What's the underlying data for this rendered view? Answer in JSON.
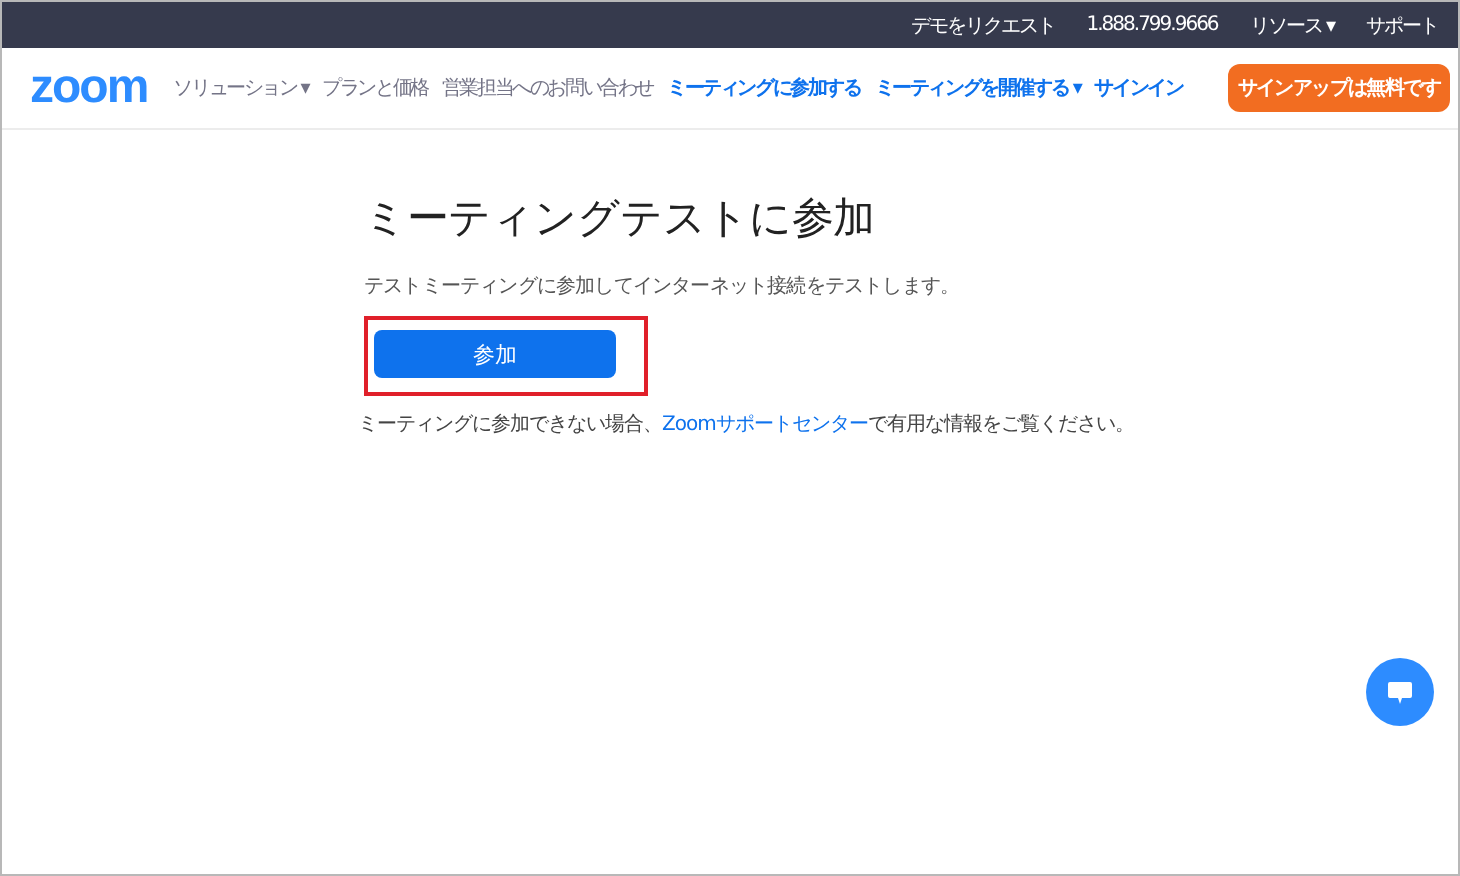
{
  "top_bar": {
    "links": [
      "デモをリクエスト",
      "1.888.799.9666",
      "リソース ▾",
      "サポート"
    ]
  },
  "nav": {
    "logo": "zoom",
    "items": [
      {
        "label": "ソリューション ▾",
        "kind": "plain"
      },
      {
        "label": "プランと価格",
        "kind": "plain"
      },
      {
        "label": "営業担当へのお問い合わせ",
        "kind": "plain"
      },
      {
        "label": "ミーティングに参加する",
        "kind": "accent"
      },
      {
        "label": "ミーティングを開催する ▾",
        "kind": "accent"
      },
      {
        "label": "サインイン",
        "kind": "accent"
      }
    ],
    "signup_button": "サインアップは無料です"
  },
  "main": {
    "title": "ミーティングテストに参加",
    "description": "テストミーティングに参加してインターネット接続をテストします。",
    "join_button": "参加",
    "join_highlighted": true,
    "help": {
      "before": "ミーティングに参加できない場合、",
      "link": "Zoomサポートセンター",
      "after": "で有用な情報をご覧ください。"
    }
  }
}
